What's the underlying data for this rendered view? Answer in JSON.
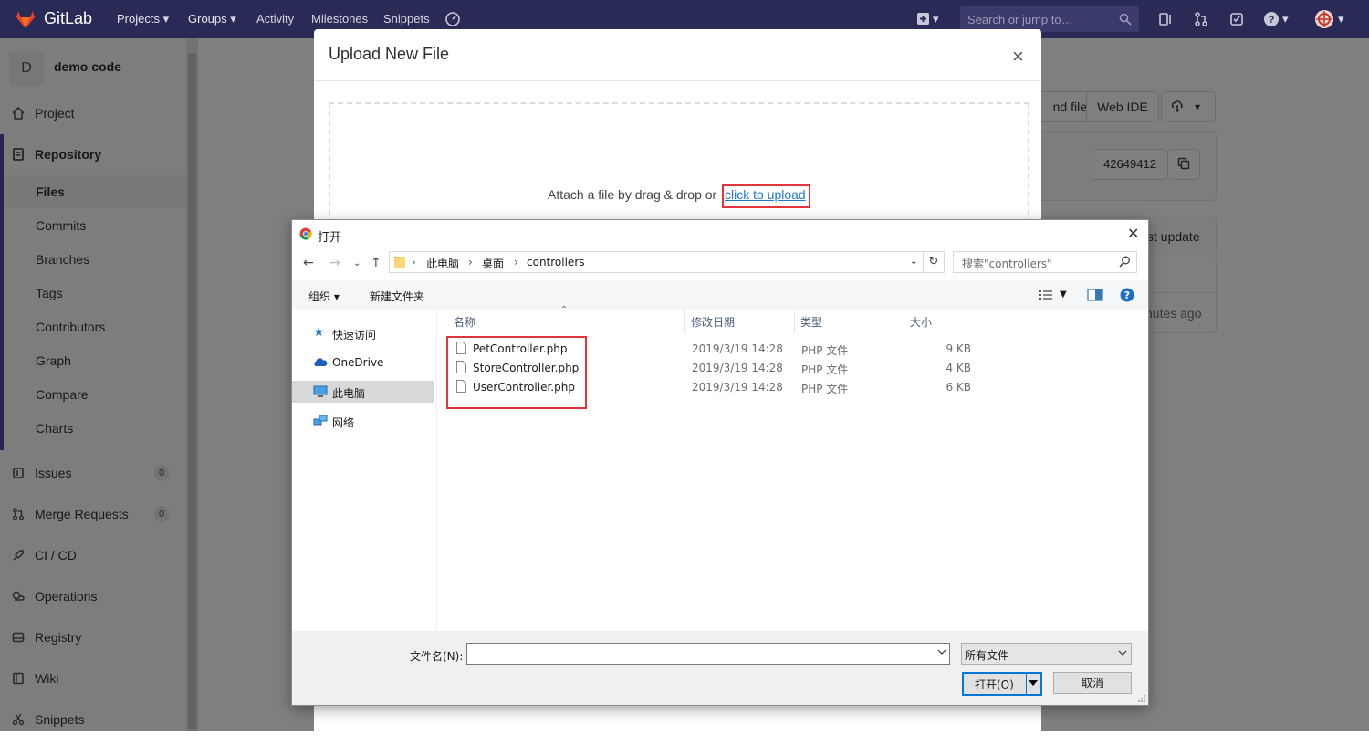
{
  "gitlab": {
    "brand": "GitLab",
    "nav": [
      "Projects",
      "Groups",
      "Activity",
      "Milestones",
      "Snippets"
    ],
    "search_placeholder": "Search or jump to…"
  },
  "sidebar": {
    "project_initial": "D",
    "project_name": "demo code",
    "items": [
      {
        "label": "Project"
      },
      {
        "label": "Repository"
      },
      {
        "label": "Files"
      },
      {
        "label": "Commits"
      },
      {
        "label": "Branches"
      },
      {
        "label": "Tags"
      },
      {
        "label": "Contributors"
      },
      {
        "label": "Graph"
      },
      {
        "label": "Compare"
      },
      {
        "label": "Charts"
      },
      {
        "label": "Issues",
        "count": "0"
      },
      {
        "label": "Merge Requests",
        "count": "0"
      },
      {
        "label": "CI / CD"
      },
      {
        "label": "Operations"
      },
      {
        "label": "Registry"
      },
      {
        "label": "Wiki"
      },
      {
        "label": "Snippets"
      }
    ]
  },
  "background": {
    "add_file_fragment": "nd file",
    "web_ide": "Web IDE",
    "commit_id": "42649412",
    "last_update_fragment": "st update",
    "time_fragment": "nutes ago"
  },
  "modal": {
    "title": "Upload New File",
    "close": "×",
    "drop_text": "Attach a file by drag & drop or",
    "upload_link": "click to upload"
  },
  "dialog": {
    "title": "打开",
    "close": "✕",
    "breadcrumb": [
      "此电脑",
      "桌面",
      "controllers"
    ],
    "search_placeholder": "搜索\"controllers\"",
    "organize": "组织",
    "new_folder": "新建文件夹",
    "nav": [
      "快速访问",
      "OneDrive",
      "此电脑",
      "网络"
    ],
    "columns": [
      "名称",
      "修改日期",
      "类型",
      "大小"
    ],
    "files": [
      {
        "name": "PetController.php",
        "date": "2019/3/19 14:28",
        "type": "PHP 文件",
        "size": "9 KB"
      },
      {
        "name": "StoreController.php",
        "date": "2019/3/19 14:28",
        "type": "PHP 文件",
        "size": "4 KB"
      },
      {
        "name": "UserController.php",
        "date": "2019/3/19 14:28",
        "type": "PHP 文件",
        "size": "6 KB"
      }
    ],
    "filename_label": "文件名(N):",
    "filename_value": "",
    "filetype": "所有文件",
    "open_btn": "打开(O)",
    "cancel_btn": "取消"
  },
  "colors": {
    "gitlab_topbar": "#2a2a57",
    "link": "#1f78d1",
    "highlight_red": "#e0353b",
    "dialog_accent": "#0078d7"
  }
}
